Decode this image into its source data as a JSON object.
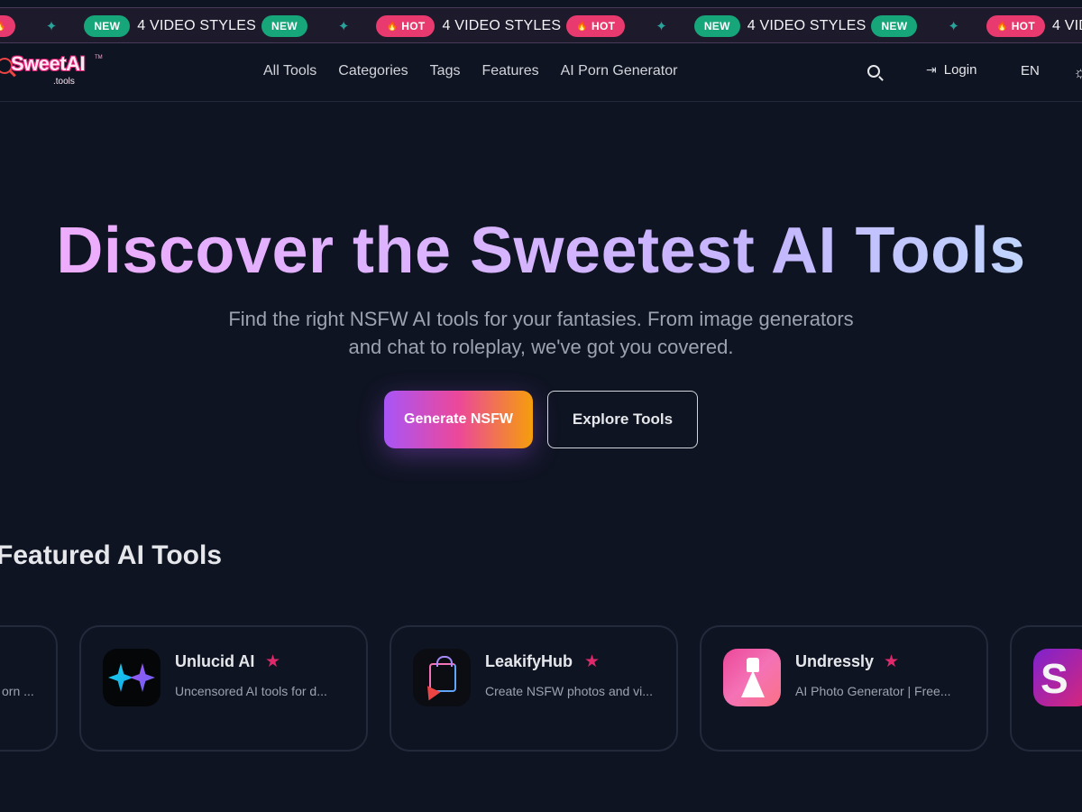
{
  "ticker": {
    "items": [
      {
        "badge": "NEW",
        "text": "4 VIDEO STYLES",
        "kind": "new"
      },
      {
        "badge": "HOT",
        "text": "4 VIDEO STYLES",
        "kind": "hot"
      },
      {
        "badge": "NEW",
        "text": "4 VIDEO STYLES",
        "kind": "new"
      },
      {
        "badge": "HOT",
        "text": "4 VIDEO STYLES",
        "kind": "hot"
      }
    ],
    "sparkle": "✦",
    "flame": "🔥"
  },
  "header": {
    "logo_main": "SweetAI",
    "logo_tm": "TM",
    "logo_sub": ".tools",
    "nav": [
      "All Tools",
      "Categories",
      "Tags",
      "Features",
      "AI Porn Generator"
    ],
    "login_label": "Login",
    "lang_label": "EN",
    "theme_icon": "☼"
  },
  "hero": {
    "title": "Discover the Sweetest AI Tools",
    "subtitle": "Find the right NSFW AI tools for your fantasies. From image generators and chat to roleplay, we've got you covered.",
    "primary_button": "Generate NSFW",
    "secondary_button": "Explore Tools"
  },
  "featured": {
    "title": "Featured AI Tools",
    "star": "★",
    "cards": [
      {
        "name": "",
        "desc": "orn ..."
      },
      {
        "name": "Unlucid AI",
        "desc": "Uncensored AI tools for d..."
      },
      {
        "name": "LeakifyHub",
        "desc": "Create NSFW photos and vi..."
      },
      {
        "name": "Undressly",
        "desc": "AI Photo Generator | Free..."
      },
      {
        "name": "",
        "desc": "",
        "logo_letter": "S"
      }
    ]
  },
  "colors": {
    "background": "#0f1422",
    "badge_new": "#16a67a",
    "badge_hot": "#e83a6e",
    "star": "#e0286a"
  }
}
